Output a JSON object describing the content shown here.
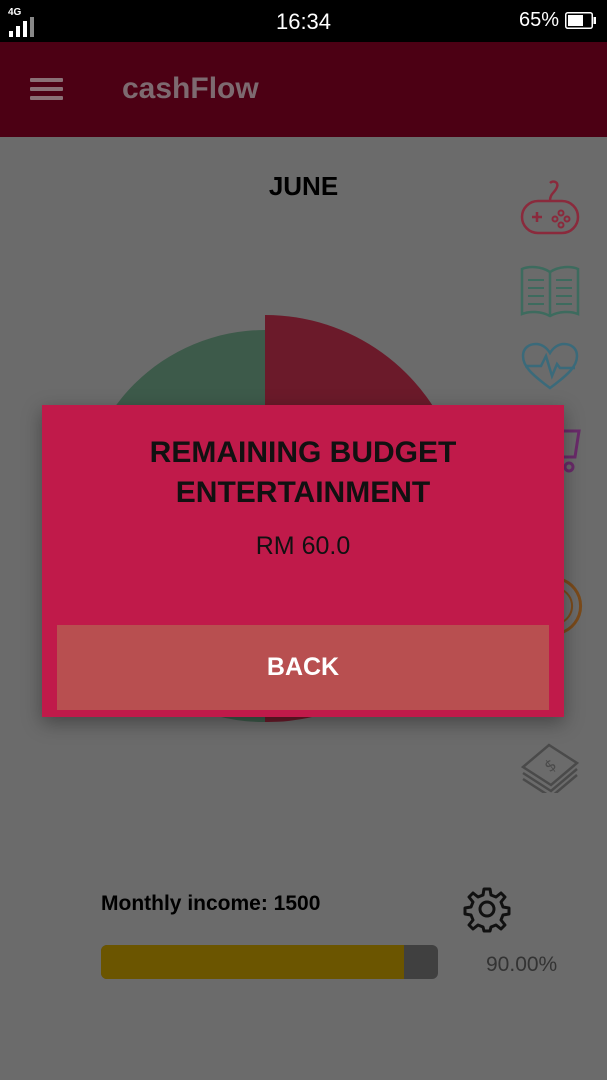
{
  "status_bar": {
    "network_type": "4G",
    "time": "16:34",
    "battery_percent": "65%"
  },
  "app_bar": {
    "title": "cashFlow",
    "menu_icon": "hamburger-menu-icon"
  },
  "main": {
    "month": "JUNE",
    "side_icons": [
      "gamepad-icon",
      "book-icon",
      "heartbeat-icon",
      "cart-icon",
      "coin-icon",
      "money-stack-icon"
    ],
    "income_label": "Monthly income: 1500",
    "progress_fraction": 0.9,
    "progress_percent_text": "90.00%",
    "settings_icon": "gear-icon"
  },
  "dialog": {
    "title": "REMAINING BUDGET ENTERTAINMENT",
    "amount": "RM 60.0",
    "back_label": "BACK"
  },
  "colors": {
    "app_bar": "#4c0014",
    "dialog_bg": "#c01a4a",
    "back_button": "#b84f50",
    "progress_fill": "#6b5500",
    "pie_green": "#3d5a4a",
    "pie_red": "#6b1a2a"
  }
}
